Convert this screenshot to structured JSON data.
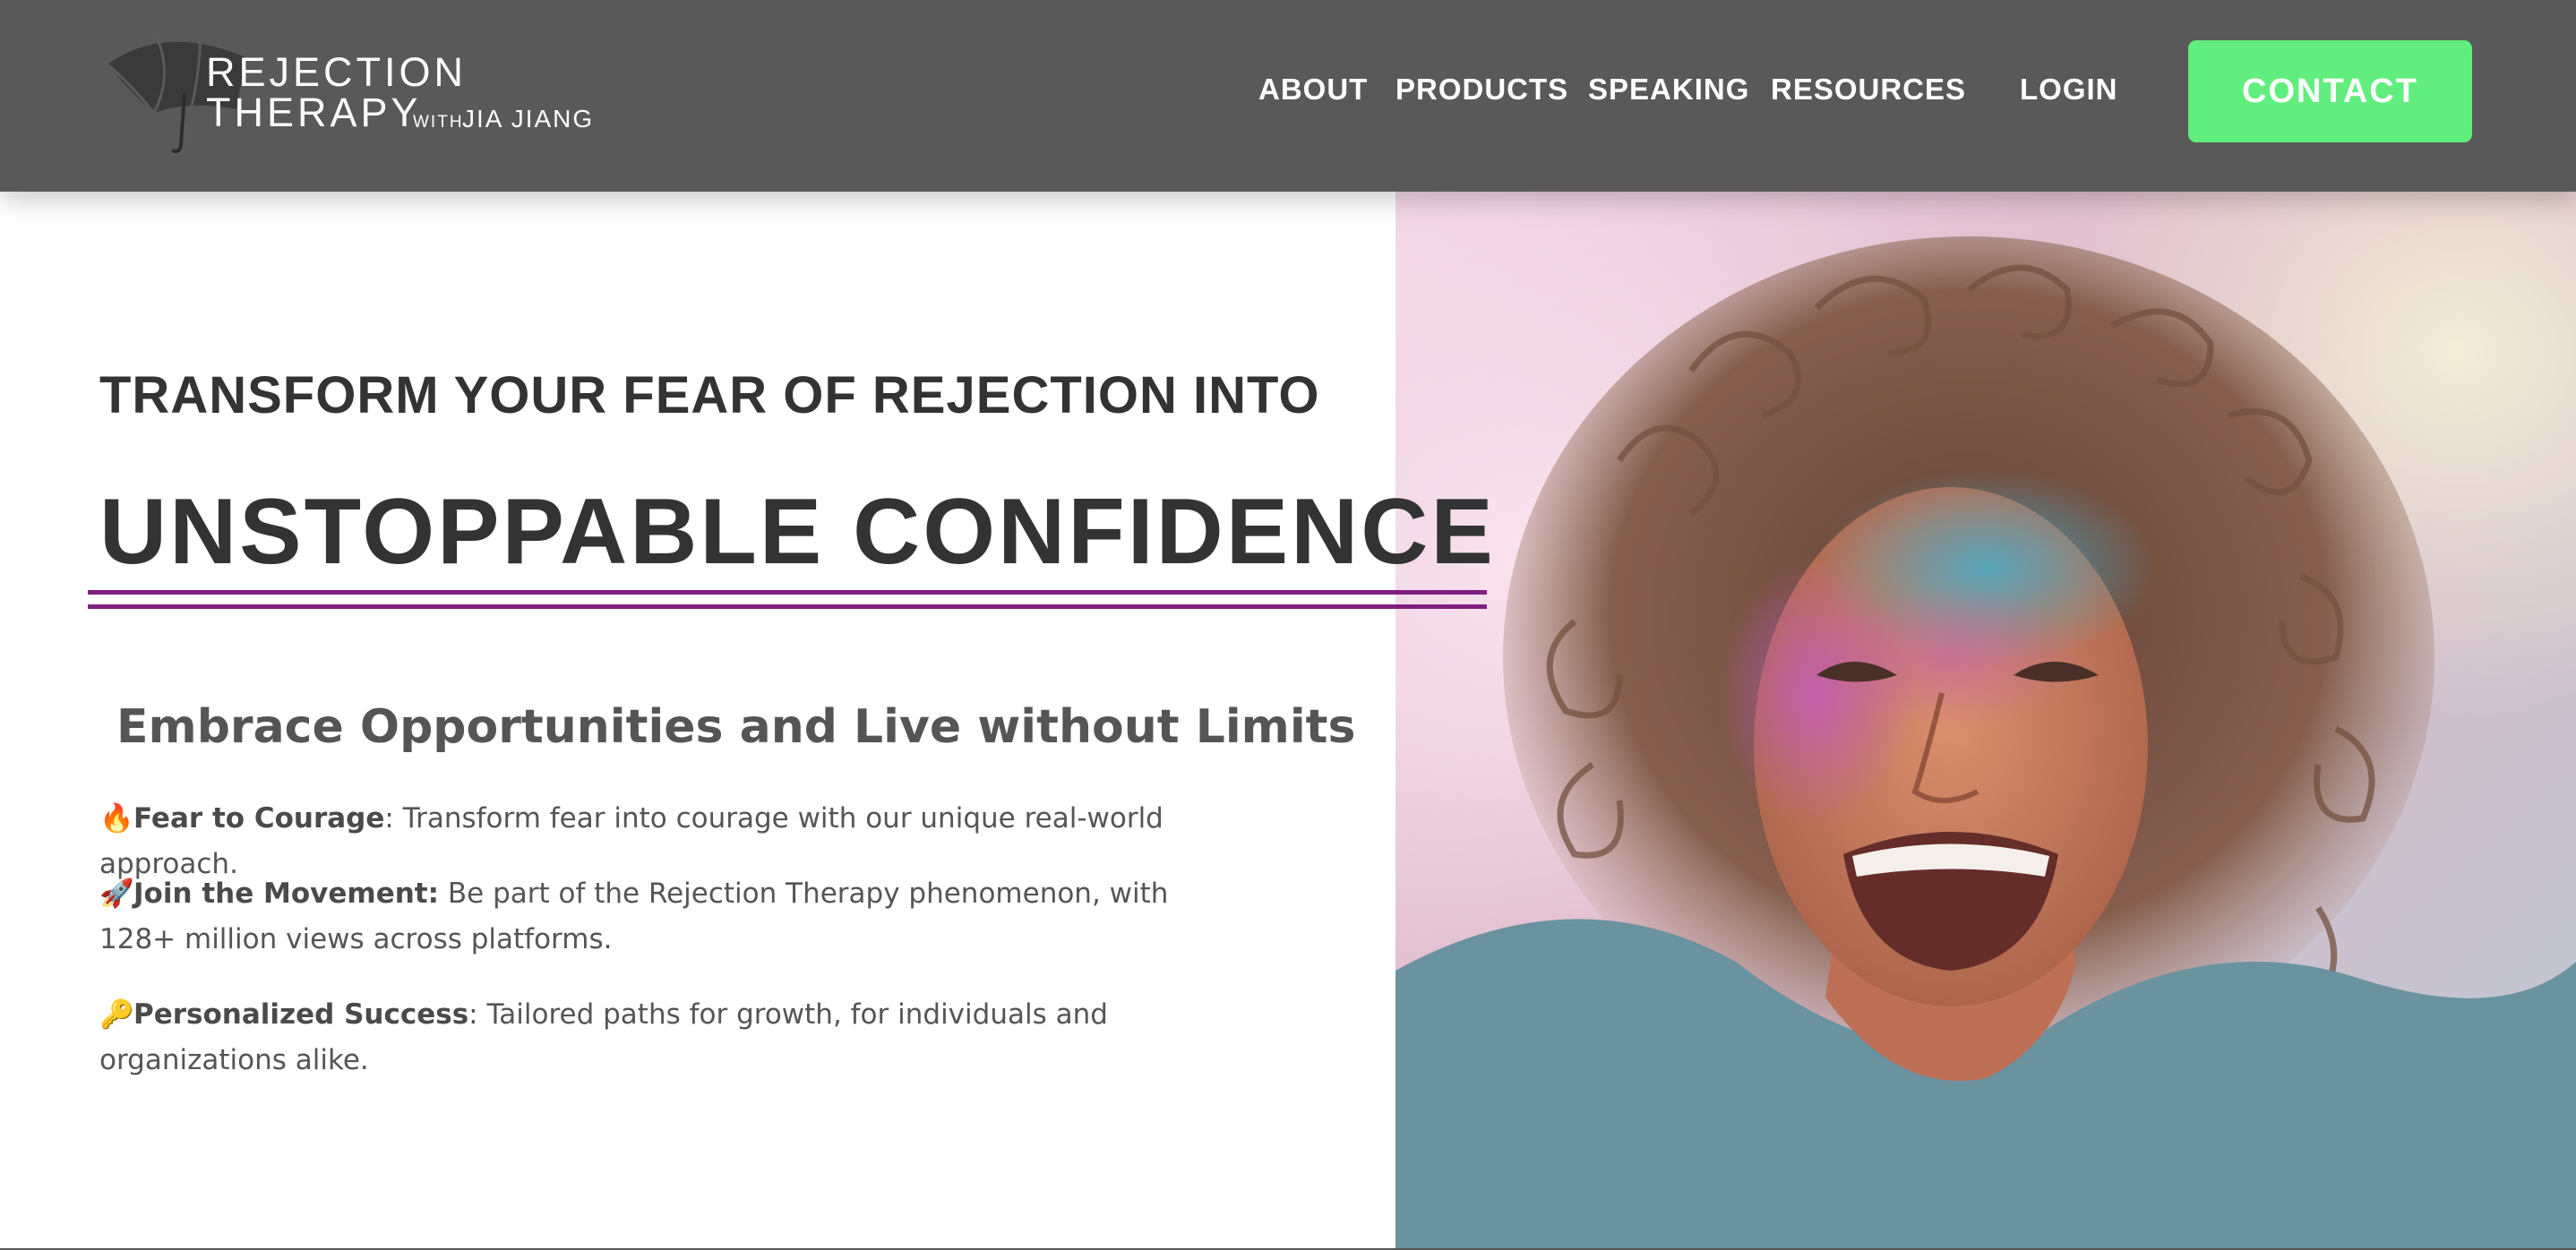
{
  "header": {
    "logo": {
      "line1": "REJECTION",
      "line2": "THERAPY",
      "with": "WITH",
      "name": "JIA JIANG"
    },
    "nav": [
      {
        "label": "ABOUT"
      },
      {
        "label": "PRODUCTS"
      },
      {
        "label": "SPEAKING"
      },
      {
        "label": "RESOURCES"
      },
      {
        "label": "LOGIN"
      }
    ],
    "contact_label": "CONTACT"
  },
  "hero": {
    "pre_title": "TRANSFORM YOUR FEAR OF REJECTION INTO",
    "title": "UNSTOPPABLE CONFIDENCE",
    "subheading": "Embrace Opportunities and Live without Limits",
    "bullets": [
      {
        "emoji": "🔥",
        "bold": "Fear to Courage",
        "text": ": Transform fear into courage with our unique real-world approach."
      },
      {
        "emoji": "🚀",
        "bold": "Join the Movement:",
        "text": " Be part of the Rejection Therapy phenomenon, with 128+ million views across platforms."
      },
      {
        "emoji": "🔑",
        "bold": "Personalized Success",
        "text": ": Tailored paths for growth, for individuals and organizations alike."
      }
    ]
  },
  "colors": {
    "header_bg": "#595959",
    "contact_bg": "#62ee7e",
    "title_text": "#333333",
    "underline": "#7f1f7f",
    "body_text": "#555555"
  },
  "icons": {
    "logo_mark": "umbrella-icon"
  }
}
